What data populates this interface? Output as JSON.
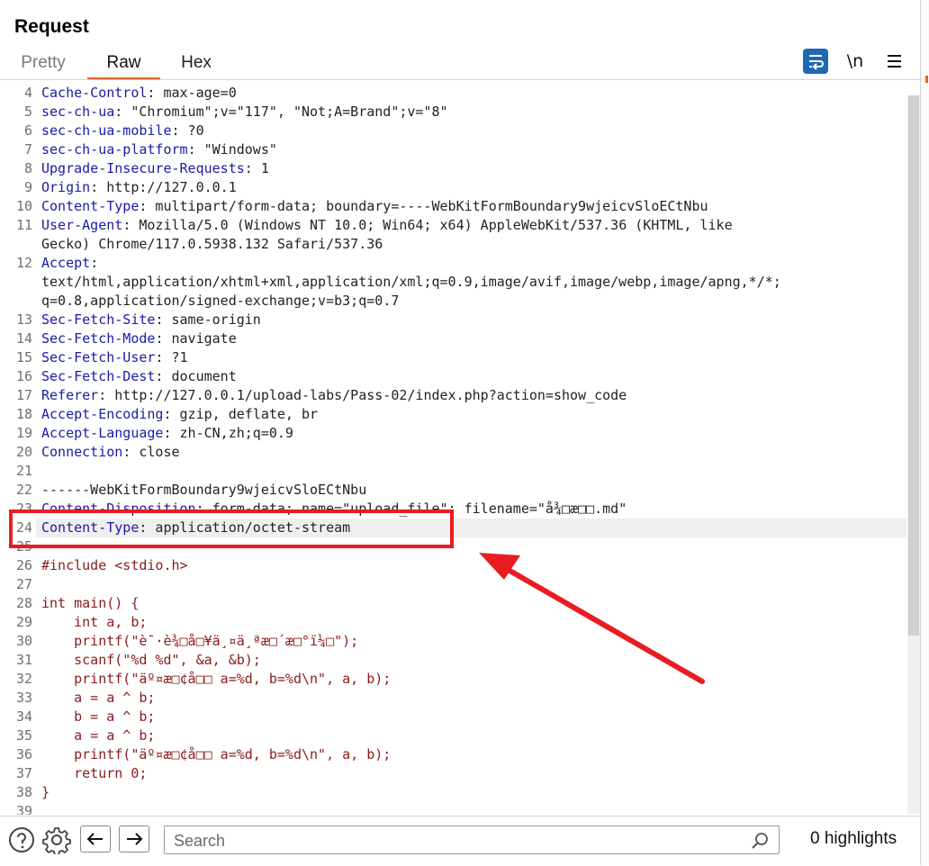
{
  "panel": {
    "title": "Request"
  },
  "tabs": [
    {
      "label": "Pretty"
    },
    {
      "label": "Raw"
    },
    {
      "label": "Hex"
    }
  ],
  "toolbar": {
    "newline_label": "\\n"
  },
  "lines": [
    {
      "n": "4",
      "k": "Cache-Control",
      "v": ": max-age=0"
    },
    {
      "n": "5",
      "k": "sec-ch-ua",
      "v": ": \"Chromium\";v=\"117\", \"Not;A=Brand\";v=\"8\""
    },
    {
      "n": "6",
      "k": "sec-ch-ua-mobile",
      "v": ": ?0"
    },
    {
      "n": "7",
      "k": "sec-ch-ua-platform",
      "v": ": \"Windows\""
    },
    {
      "n": "8",
      "k": "Upgrade-Insecure-Requests",
      "v": ": 1"
    },
    {
      "n": "9",
      "k": "Origin",
      "v": ": http://127.0.0.1"
    },
    {
      "n": "10",
      "k": "Content-Type",
      "v": ": multipart/form-data; boundary=----WebKitFormBoundary9wjeicvSloECtNbu"
    },
    {
      "n": "11",
      "k": "User-Agent",
      "v": ": Mozilla/5.0 (Windows NT 10.0; Win64; x64) AppleWebKit/537.36 (KHTML, like"
    },
    {
      "n": "",
      "k": "",
      "v": "Gecko) Chrome/117.0.5938.132 Safari/537.36"
    },
    {
      "n": "12",
      "k": "Accept",
      "v": ":"
    },
    {
      "n": "",
      "k": "",
      "v": "text/html,application/xhtml+xml,application/xml;q=0.9,image/avif,image/webp,image/apng,*/*;"
    },
    {
      "n": "",
      "k": "",
      "v": "q=0.8,application/signed-exchange;v=b3;q=0.7"
    },
    {
      "n": "13",
      "k": "Sec-Fetch-Site",
      "v": ": same-origin"
    },
    {
      "n": "14",
      "k": "Sec-Fetch-Mode",
      "v": ": navigate"
    },
    {
      "n": "15",
      "k": "Sec-Fetch-User",
      "v": ": ?1"
    },
    {
      "n": "16",
      "k": "Sec-Fetch-Dest",
      "v": ": document"
    },
    {
      "n": "17",
      "k": "Referer",
      "v": ": http://127.0.0.1/upload-labs/Pass-02/index.php?action=show_code"
    },
    {
      "n": "18",
      "k": "Accept-Encoding",
      "v": ": gzip, deflate, br"
    },
    {
      "n": "19",
      "k": "Accept-Language",
      "v": ": zh-CN,zh;q=0.9"
    },
    {
      "n": "20",
      "k": "Connection",
      "v": ": close"
    },
    {
      "n": "21",
      "k": "",
      "v": ""
    },
    {
      "n": "22",
      "k": "",
      "v": "------WebKitFormBoundary9wjeicvSloECtNbu"
    },
    {
      "n": "23",
      "k": "Content-Disposition",
      "v": ": form-data; name=\"upload_file\"; filename=\"å¾□æ□□.md\""
    },
    {
      "n": "24",
      "k": "Content-Type",
      "v": ": application/octet-stream"
    },
    {
      "n": "25",
      "k": "",
      "v": ""
    },
    {
      "n": "26",
      "k": "",
      "v": "#include <stdio.h>",
      "body": true
    },
    {
      "n": "27",
      "k": "",
      "v": ""
    },
    {
      "n": "28",
      "k": "",
      "v": "int main() {",
      "body": true
    },
    {
      "n": "29",
      "k": "",
      "v": "    int a, b;",
      "body": true
    },
    {
      "n": "30",
      "k": "",
      "v": "    printf(\"è¯·è¾□å□¥ä¸¤ä¸ªæ□´æ□°ï¼□\");",
      "body": true
    },
    {
      "n": "31",
      "k": "",
      "v": "    scanf(\"%d %d\", &a, &b);",
      "body": true
    },
    {
      "n": "32",
      "k": "",
      "v": "    printf(\"äº¤æ□¢å□□ a=%d, b=%d\\n\", a, b);",
      "body": true
    },
    {
      "n": "33",
      "k": "",
      "v": "    a = a ^ b;",
      "body": true
    },
    {
      "n": "34",
      "k": "",
      "v": "    b = a ^ b;",
      "body": true
    },
    {
      "n": "35",
      "k": "",
      "v": "    a = a ^ b;",
      "body": true
    },
    {
      "n": "36",
      "k": "",
      "v": "    printf(\"äº¤æ□¢å□□ a=%d, b=%d\\n\", a, b);",
      "body": true
    },
    {
      "n": "37",
      "k": "",
      "v": "    return 0;",
      "body": true
    },
    {
      "n": "38",
      "k": "",
      "v": "}",
      "body": true
    },
    {
      "n": "39",
      "k": "",
      "v": ""
    }
  ],
  "highlighted_line": "24",
  "search": {
    "placeholder": "Search",
    "value": ""
  },
  "highlights_label": "0 highlights",
  "colors": {
    "accent": "#e8622c",
    "annotation": "#ea1c23",
    "header_key": "#1a1aa6",
    "body_text": "#8b1a1a"
  },
  "icons": [
    "wrap-lines-icon",
    "menu-icon",
    "help-icon",
    "settings-gear-icon",
    "arrow-left-icon",
    "arrow-right-icon",
    "search-icon"
  ]
}
